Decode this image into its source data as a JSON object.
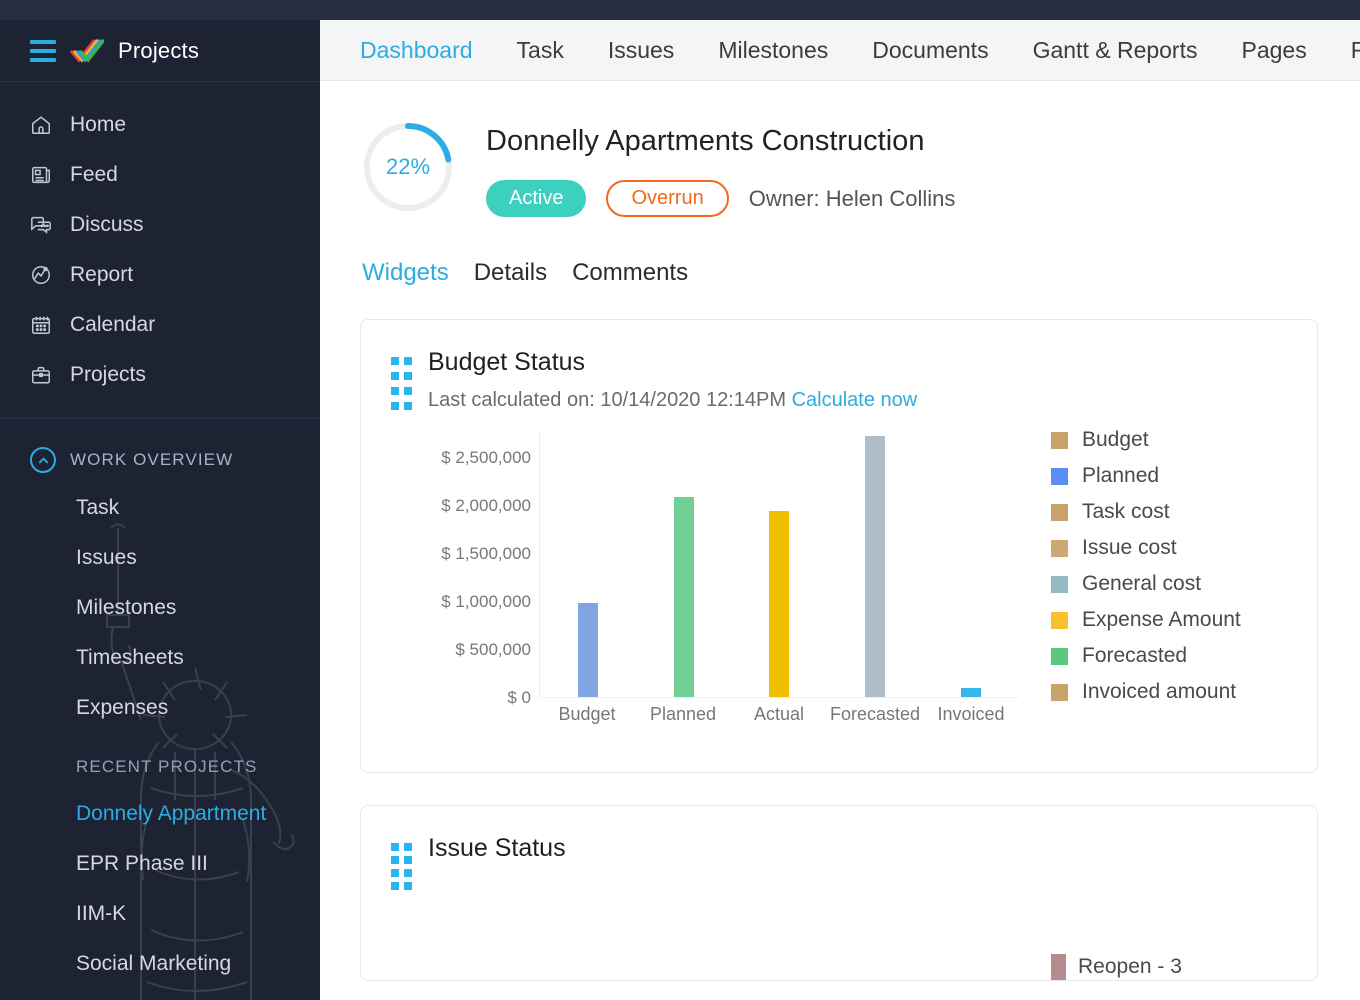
{
  "brand": {
    "app_name": "Projects",
    "menu_icon": "hamburger-icon",
    "logo_icon": "zoho-check-logo",
    "accent": "#2cace3",
    "sidebar_bg": "#1d2333"
  },
  "sidebar": {
    "nav": [
      {
        "label": "Home",
        "icon": "home-icon"
      },
      {
        "label": "Feed",
        "icon": "feed-icon"
      },
      {
        "label": "Discuss",
        "icon": "discuss-icon"
      },
      {
        "label": "Report",
        "icon": "report-icon"
      },
      {
        "label": "Calendar",
        "icon": "calendar-icon"
      },
      {
        "label": "Projects",
        "icon": "briefcase-icon"
      }
    ],
    "work_overview": {
      "label": "WORK OVERVIEW",
      "icon": "chevron-up-circle-icon",
      "items": [
        {
          "label": "Task"
        },
        {
          "label": "Issues"
        },
        {
          "label": "Milestones"
        },
        {
          "label": "Timesheets"
        },
        {
          "label": "Expenses"
        }
      ]
    },
    "recent_projects": {
      "label": "RECENT PROJECTS",
      "items": [
        {
          "label": "Donnely Appartment",
          "active": true
        },
        {
          "label": "EPR Phase III",
          "active": false
        },
        {
          "label": "IIM-K",
          "active": false
        },
        {
          "label": "Social Marketing",
          "active": false
        }
      ]
    },
    "watermark_icon": "statue-of-liberty-illustration"
  },
  "tabbar": {
    "tabs": [
      {
        "label": "Dashboard",
        "active": true
      },
      {
        "label": "Task",
        "active": false
      },
      {
        "label": "Issues",
        "active": false
      },
      {
        "label": "Milestones",
        "active": false
      },
      {
        "label": "Documents",
        "active": false
      },
      {
        "label": "Gantt & Reports",
        "active": false
      },
      {
        "label": "Pages",
        "active": false
      },
      {
        "label": "Finan",
        "active": false
      }
    ]
  },
  "project": {
    "progress_percent": "22%",
    "progress_value": 22,
    "title": "Donnelly Apartments Construction",
    "status_badge": "Active",
    "status_badge_color": "#3cd0bf",
    "alert_badge": "Overrun",
    "alert_badge_color": "#f2681c",
    "owner": "Owner: Helen Collins"
  },
  "subtabs": [
    {
      "label": "Widgets",
      "active": true
    },
    {
      "label": "Details",
      "active": false
    },
    {
      "label": "Comments",
      "active": false
    }
  ],
  "budget_widget": {
    "drag_handle_icon": "drag-grid-icon",
    "title": "Budget Status",
    "last_calculated": "Last calculated on: 10/14/2020 12:14PM",
    "calculate_link": "Calculate now"
  },
  "issue_widget": {
    "drag_handle_icon": "drag-grid-icon",
    "title": "Issue Status",
    "legend": [
      {
        "label": "Reopen - 3",
        "color": "#b58b8e"
      }
    ]
  },
  "chart_data": {
    "type": "bar",
    "title": "Budget Status",
    "xlabel": "",
    "ylabel": "",
    "categories": [
      "Budget",
      "Planned",
      "Actual",
      "Forecasted",
      "Invoiced"
    ],
    "values": [
      980000,
      2080000,
      1940000,
      2720000,
      90000
    ],
    "bar_colors": [
      "#7fa5e3",
      "#6fcf97",
      "#f0c000",
      "#aebdc8",
      "#35b6ec"
    ],
    "ylim": [
      0,
      2750000
    ],
    "yticks": [
      {
        "value": 2500000,
        "label": "$ 2,500,000"
      },
      {
        "value": 2000000,
        "label": "$ 2,000,000"
      },
      {
        "value": 1500000,
        "label": "$ 1,500,000"
      },
      {
        "value": 1000000,
        "label": "$ 1,000,000"
      },
      {
        "value": 500000,
        "label": "$ 500,000"
      },
      {
        "value": 0,
        "label": "$ 0"
      }
    ],
    "grid": false,
    "legend_position": "right",
    "legend": [
      {
        "name": "Budget",
        "color": "#c9a36b"
      },
      {
        "name": "Planned",
        "color": "#5b8ef5"
      },
      {
        "name": "Task cost",
        "color": "#c9a36b"
      },
      {
        "name": "Issue cost",
        "color": "#cda873"
      },
      {
        "name": "General cost",
        "color": "#92bdc0"
      },
      {
        "name": "Expense Amount",
        "color": "#fbc02d"
      },
      {
        "name": "Forecasted",
        "color": "#5cc87f"
      },
      {
        "name": "Invoiced amount",
        "color": "#c9a36b"
      }
    ]
  }
}
